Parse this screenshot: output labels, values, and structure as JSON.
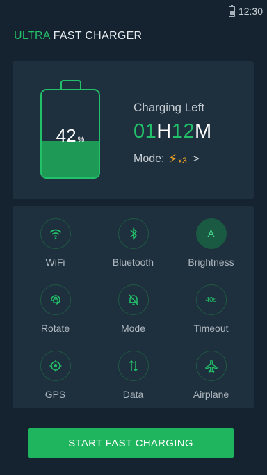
{
  "status_bar": {
    "time": "12:30"
  },
  "app": {
    "title_accent": "ULTRA",
    "title_rest": "FAST CHARGER"
  },
  "battery": {
    "level_value": "42",
    "level_unit": "%",
    "level_fraction": 0.42,
    "charging_label": "Charging Left",
    "time_hours": "01",
    "time_hours_unit": "H",
    "time_minutes": "12",
    "time_minutes_unit": "M",
    "mode_label": "Mode:",
    "mode_multiplier": "x3",
    "mode_chevron": ">"
  },
  "tiles": [
    {
      "label": "WiFi",
      "icon": "wifi-icon",
      "active": false
    },
    {
      "label": "Bluetooth",
      "icon": "bluetooth-icon",
      "active": false
    },
    {
      "label": "Brightness",
      "icon": "brightness-icon",
      "icon_text": "A",
      "active": true
    },
    {
      "label": "Rotate",
      "icon": "rotate-icon",
      "active": false
    },
    {
      "label": "Mode",
      "icon": "bell-mute-icon",
      "active": false
    },
    {
      "label": "Timeout",
      "icon": "timeout-icon",
      "icon_text": "40s",
      "active": false
    },
    {
      "label": "GPS",
      "icon": "gps-icon",
      "active": false
    },
    {
      "label": "Data",
      "icon": "data-icon",
      "active": false
    },
    {
      "label": "Airplane",
      "icon": "airplane-icon",
      "active": false
    }
  ],
  "actions": {
    "start_label": "START FAST CHARGING"
  },
  "colors": {
    "background": "#152330",
    "card": "#1e2f3d",
    "accent": "#23c06a",
    "mode_accent": "#f6a623"
  }
}
